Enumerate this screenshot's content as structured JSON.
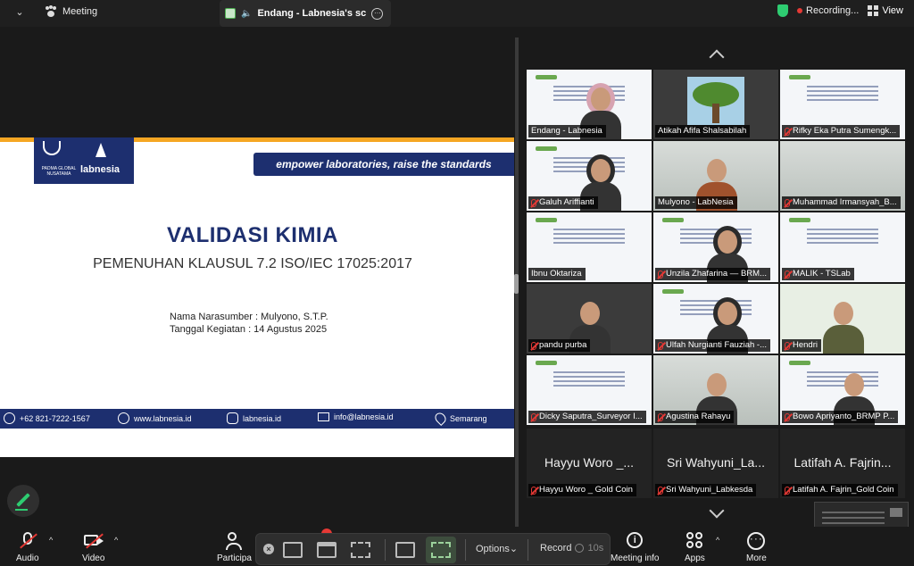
{
  "topbar": {
    "meeting_label": "Meeting",
    "share_title": "Endang - Labnesia's scre",
    "recording_label": "Recording...",
    "view_label": "View"
  },
  "slide": {
    "logo_padma_text": "PADMA GLOBAL NUSATAMA",
    "logo_brand": "labnesia",
    "slogan": "empower laboratories, raise the standards",
    "title": "VALIDASI KIMIA",
    "subtitle": "PEMENUHAN KLAUSUL 7.2 ISO/IEC 17025:2017",
    "speaker_line": "Nama Narasumber : Mulyono, S.T.P.",
    "date_line": "Tanggal Kegiatan : 14 Agustus 2025",
    "footer": {
      "phone": "+62 821-7222-1567",
      "website": "www.labnesia.id",
      "instagram": "labnesia.id",
      "email": "info@labnesia.id",
      "location": "Semarang"
    }
  },
  "gallery": {
    "participants": [
      {
        "name": "Endang - Labnesia",
        "muted": false,
        "bg": "slide",
        "person": "hijab-pink"
      },
      {
        "name": "Atikah Afifa Shalsabilah",
        "muted": false,
        "bg": "dark",
        "person": "tree"
      },
      {
        "name": "Rifky Eka Putra Sumengk...",
        "muted": true,
        "bg": "slide",
        "person": ""
      },
      {
        "name": "Galuh Ariffianti",
        "muted": true,
        "bg": "slide",
        "person": "hijab"
      },
      {
        "name": "Mulyono - LabNesia",
        "muted": false,
        "bg": "room",
        "person": "man",
        "active": true
      },
      {
        "name": "Muhammad Irmansyah_B...",
        "muted": true,
        "bg": "room",
        "person": ""
      },
      {
        "name": "Ibnu Oktariza",
        "muted": false,
        "bg": "slide",
        "person": ""
      },
      {
        "name": "Unzila Zhafarina — BRM...",
        "muted": true,
        "bg": "slide",
        "person": "hijab"
      },
      {
        "name": "MALIK - TSLab",
        "muted": true,
        "bg": "slide",
        "person": ""
      },
      {
        "name": "pandu purba",
        "muted": true,
        "bg": "dark",
        "person": "man"
      },
      {
        "name": "Ulfah Nurgianti Fauziah -...",
        "muted": true,
        "bg": "slide",
        "person": "hijab"
      },
      {
        "name": "Hendri",
        "muted": true,
        "bg": "green",
        "person": "man"
      },
      {
        "name": "Dicky Saputra_Surveyor I...",
        "muted": true,
        "bg": "slide",
        "person": ""
      },
      {
        "name": "Agustina Rahayu",
        "muted": true,
        "bg": "room",
        "person": "woman"
      },
      {
        "name": "Bowo Apriyanto_BRMP P...",
        "muted": true,
        "bg": "slide",
        "person": "man"
      }
    ],
    "no_video": [
      {
        "display": "Hayyu Woro _...",
        "name": "Hayyu Woro _ Gold Coin"
      },
      {
        "display": "Sri Wahyuni_La...",
        "name": "Sri Wahyuni_Labkesda"
      },
      {
        "display": "Latifah A. Fajrin...",
        "name": "Latifah A. Fajrin_Gold Coin"
      }
    ]
  },
  "toolbar": {
    "audio": "Audio",
    "video": "Video",
    "participants": "Participa",
    "options": "Options",
    "record": "Record",
    "record_timer": "10s",
    "meeting_info": "Meeting info",
    "apps": "Apps",
    "more": "More"
  }
}
